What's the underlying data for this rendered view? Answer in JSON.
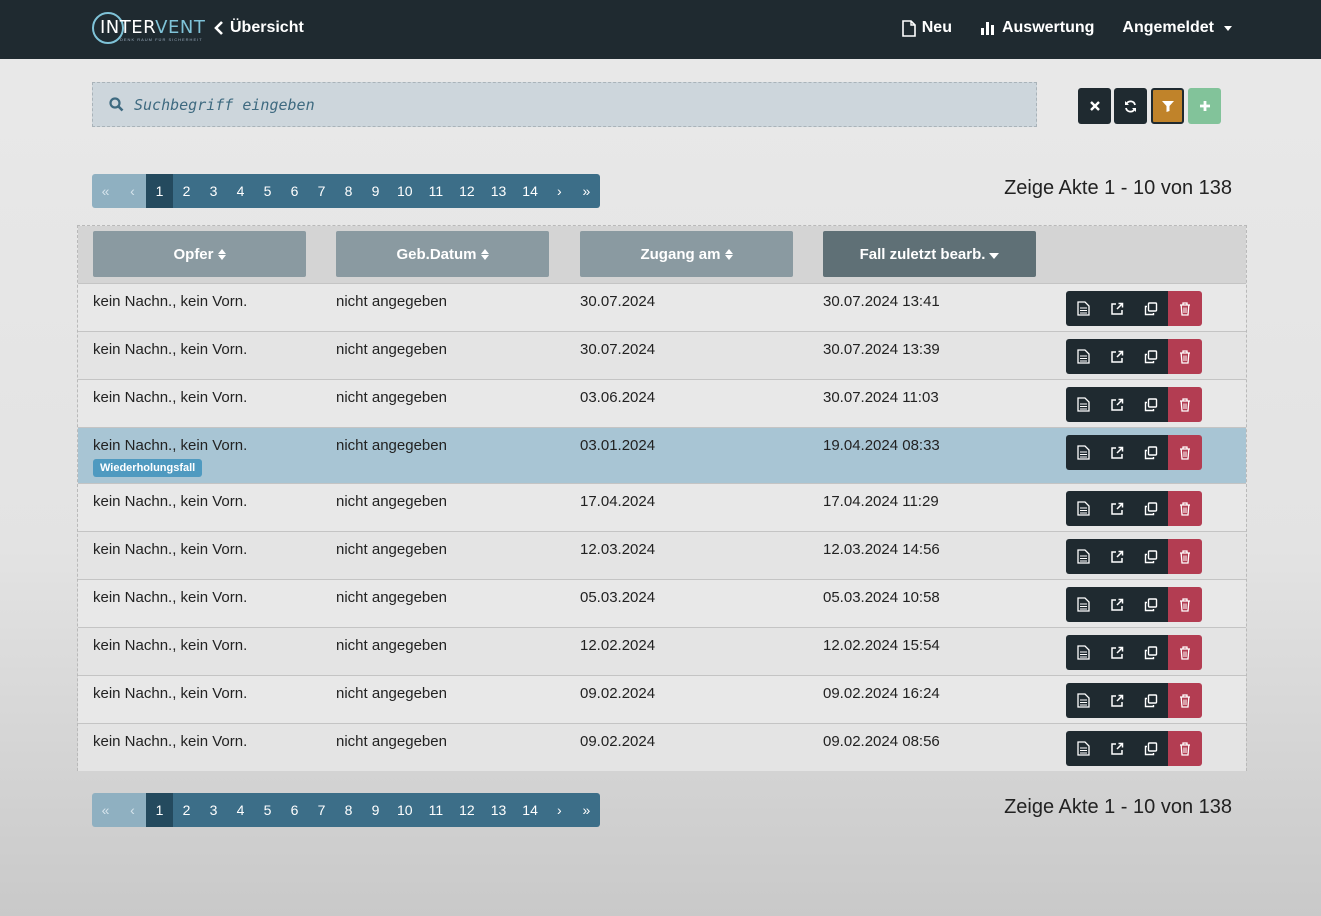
{
  "nav": {
    "logo_text_a": "IN",
    "logo_text_b": "TER",
    "logo_text_c": "VENT",
    "logo_sub": "DENK RAUM FÜR SICHERHEIT",
    "back_label": "Übersicht",
    "items": [
      {
        "label": "Neu",
        "icon": "file-icon"
      },
      {
        "label": "Auswertung",
        "icon": "bar-chart-icon"
      },
      {
        "label": "Angemeldet",
        "icon": "caret-down-icon"
      }
    ]
  },
  "search": {
    "placeholder": "Suchbegriff eingeben",
    "value": ""
  },
  "toolbar": {
    "clear": "clear-icon",
    "refresh": "refresh-icon",
    "filter": "filter-icon",
    "add": "plus-icon"
  },
  "pagination": {
    "first": "«",
    "prev": "‹",
    "pages": [
      "1",
      "2",
      "3",
      "4",
      "5",
      "6",
      "7",
      "8",
      "9",
      "10",
      "11",
      "12",
      "13",
      "14"
    ],
    "active": "1",
    "next": "›",
    "last": "»",
    "summary": "Zeige Akte 1 - 10 von 138"
  },
  "table": {
    "headers": [
      "Opfer",
      "Geb.Datum",
      "Zugang am",
      "Fall zuletzt bearb."
    ],
    "rows": [
      {
        "name": "kein Nachn., kein Vorn.",
        "dob": "nicht angegeben",
        "received": "30.07.2024",
        "edited": "30.07.2024 13:41",
        "badge": ""
      },
      {
        "name": "kein Nachn., kein Vorn.",
        "dob": "nicht angegeben",
        "received": "30.07.2024",
        "edited": "30.07.2024 13:39",
        "badge": ""
      },
      {
        "name": "kein Nachn., kein Vorn.",
        "dob": "nicht angegeben",
        "received": "03.06.2024",
        "edited": "30.07.2024 11:03",
        "badge": ""
      },
      {
        "name": "kein Nachn., kein Vorn.",
        "dob": "nicht angegeben",
        "received": "03.01.2024",
        "edited": "19.04.2024 08:33",
        "badge": "Wiederholungsfall"
      },
      {
        "name": "kein Nachn., kein Vorn.",
        "dob": "nicht angegeben",
        "received": "17.04.2024",
        "edited": "17.04.2024 11:29",
        "badge": ""
      },
      {
        "name": "kein Nachn., kein Vorn.",
        "dob": "nicht angegeben",
        "received": "12.03.2024",
        "edited": "12.03.2024 14:56",
        "badge": ""
      },
      {
        "name": "kein Nachn., kein Vorn.",
        "dob": "nicht angegeben",
        "received": "05.03.2024",
        "edited": "05.03.2024 10:58",
        "badge": ""
      },
      {
        "name": "kein Nachn., kein Vorn.",
        "dob": "nicht angegeben",
        "received": "12.02.2024",
        "edited": "12.02.2024 15:54",
        "badge": ""
      },
      {
        "name": "kein Nachn., kein Vorn.",
        "dob": "nicht angegeben",
        "received": "09.02.2024",
        "edited": "09.02.2024 16:24",
        "badge": ""
      },
      {
        "name": "kein Nachn., kein Vorn.",
        "dob": "nicht angegeben",
        "received": "09.02.2024",
        "edited": "09.02.2024 08:56",
        "badge": ""
      }
    ]
  },
  "colors": {
    "navbar": "#1f2a30",
    "pagination": "#3c6e88",
    "highlight_row": "#a8c5d4",
    "delete": "#b33d52",
    "filter": "#c0832a",
    "add": "#82c39a",
    "badge": "#4f9ac0"
  }
}
